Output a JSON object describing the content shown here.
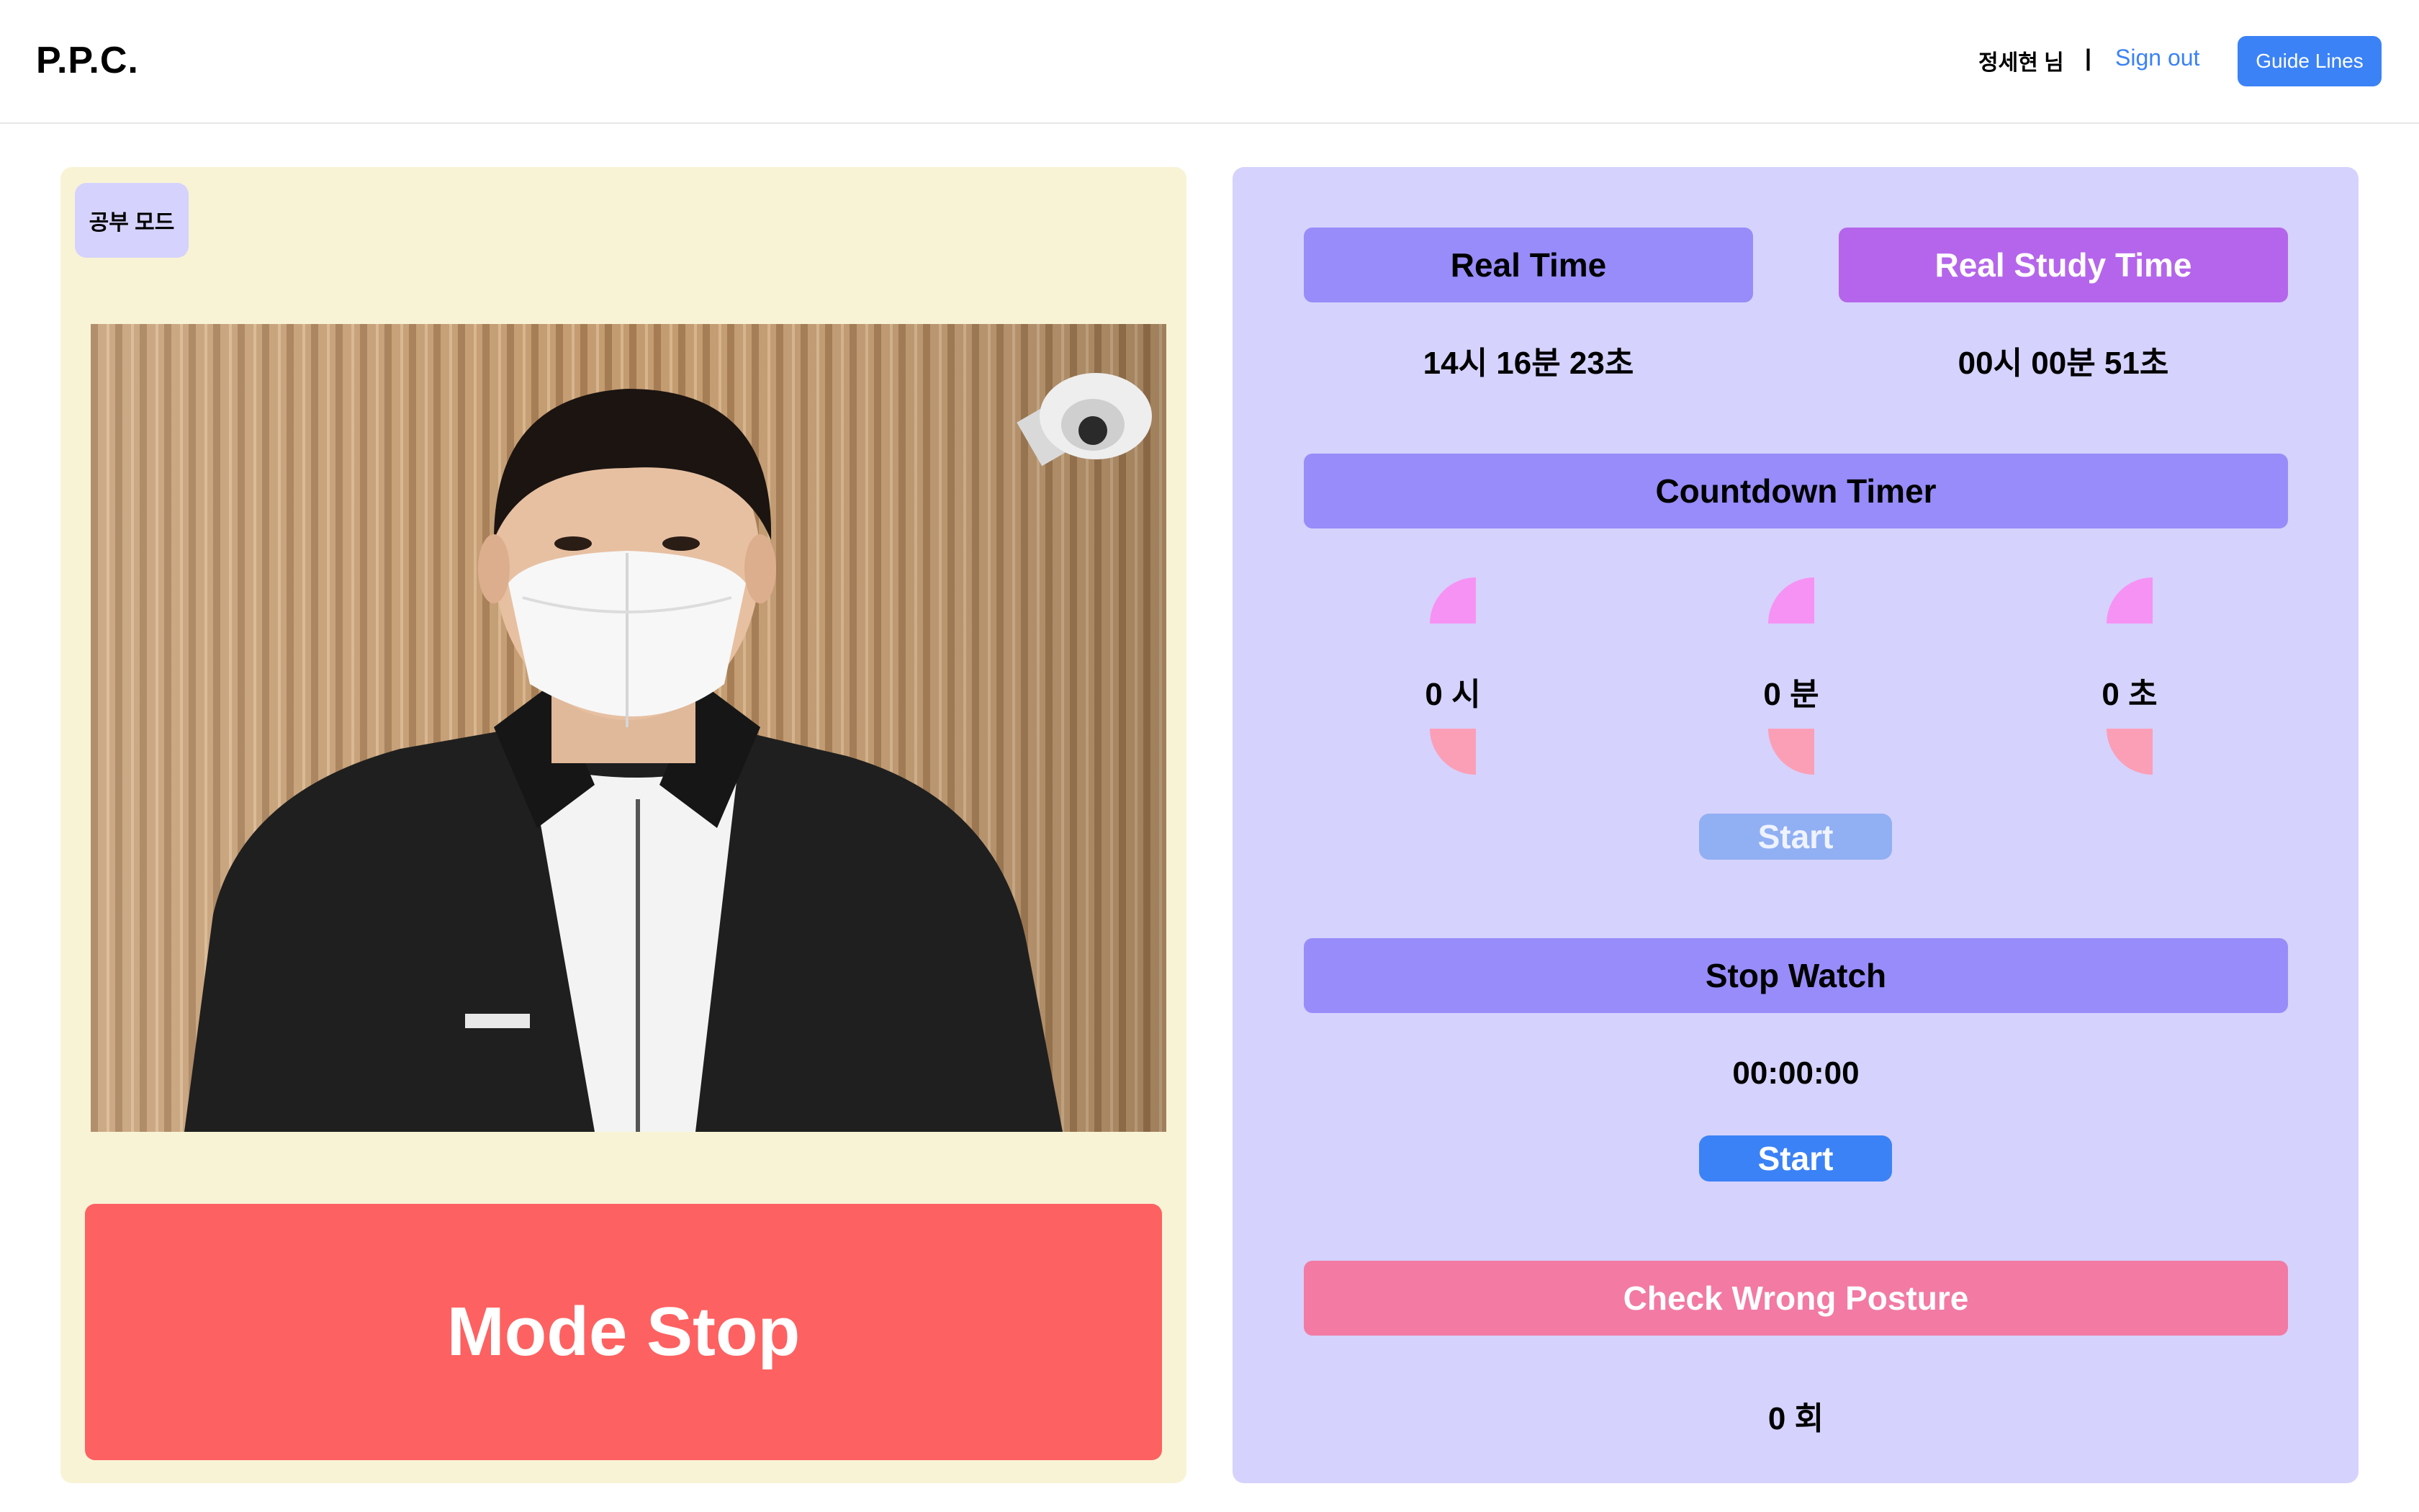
{
  "header": {
    "logo": "P.P.C.",
    "user_name": "정세현 님",
    "divider": "|",
    "signout_label": "Sign out",
    "guide_label": "Guide Lines"
  },
  "left": {
    "mode_badge": "공부 모드",
    "mode_stop_label": "Mode Stop"
  },
  "right": {
    "real_time": {
      "label": "Real Time",
      "value": "14시 16분 23초"
    },
    "real_study_time": {
      "label": "Real Study Time",
      "value": "00시 00분 51초"
    },
    "countdown": {
      "label": "Countdown Timer",
      "hours": "0 시",
      "minutes": "0 분",
      "seconds": "0 초",
      "start_label": "Start"
    },
    "stopwatch": {
      "label": "Stop Watch",
      "value": "00:00:00",
      "start_label": "Start"
    },
    "posture": {
      "label": "Check Wrong Posture",
      "count": "0 회"
    }
  },
  "colors": {
    "accent_blue": "#3b82f6",
    "left_bg": "#f9f3d6",
    "right_bg": "#d5d2fd",
    "bar_purple": "#978cf9",
    "bar_violet": "#b565eb",
    "bar_pink": "#f27aa3",
    "mode_stop_red": "#fe6161"
  }
}
